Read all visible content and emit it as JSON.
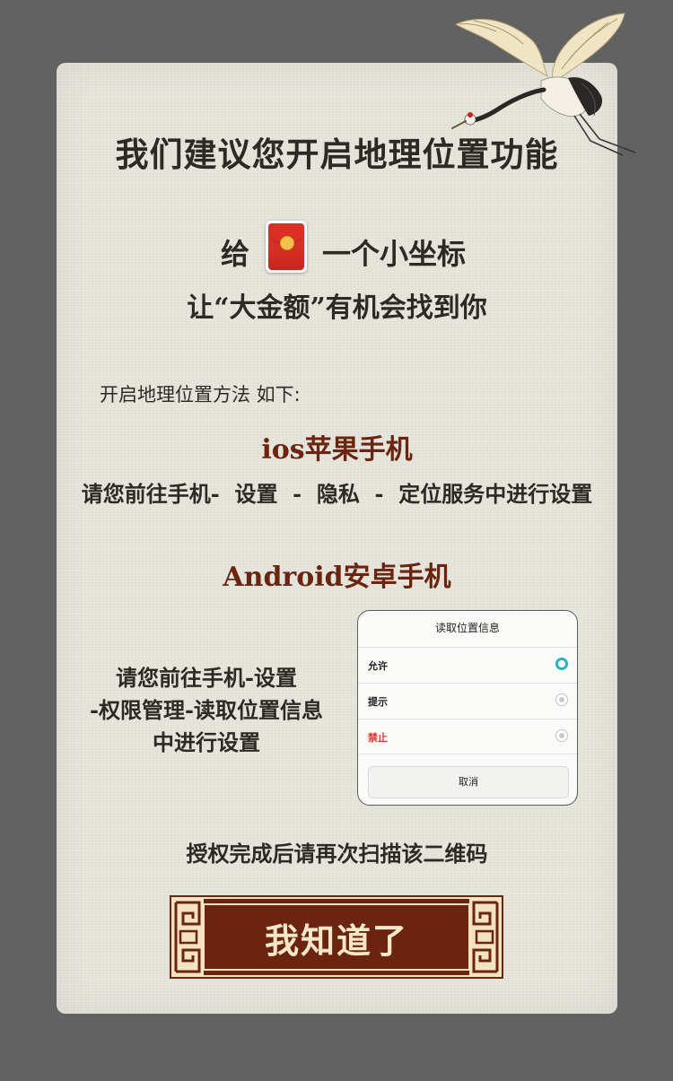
{
  "dialog_card": {
    "title": "我们建议您开启地理位置功能",
    "give_word": "给",
    "give_rest": "一个小坐标",
    "subtitle": "让“大金额”有机会找到你",
    "method_intro": "开启地理位置方法 如下:",
    "ios": {
      "title": "ios苹果手机",
      "steps": "请您前往手机-  设置  -  隐私  -  定位服务中进行设置"
    },
    "android": {
      "title": "Android安卓手机",
      "steps_lines": [
        "请您前往手机-设置",
        "-权限管理-读取位置信息",
        "中进行设置"
      ]
    },
    "sample_dialog": {
      "title": "读取位置信息",
      "options": [
        {
          "label": "允许",
          "selected": true
        },
        {
          "label": "提示",
          "selected": false
        },
        {
          "label": "禁止",
          "selected": false
        }
      ],
      "cancel": "取消"
    },
    "footer_note": "授权完成后请再次扫描该二维码",
    "confirm_button": "我知道了"
  },
  "icons": {
    "crane": "crane-illustration",
    "red_packet": "red-packet-icon"
  },
  "colors": {
    "page_background": "#626262",
    "card_background": "#e6e6dd",
    "heading_brown": "#6a2410",
    "button_brown": "#6b2410",
    "radio_accent": "#26b3bb",
    "danger_red": "#e0332a"
  }
}
